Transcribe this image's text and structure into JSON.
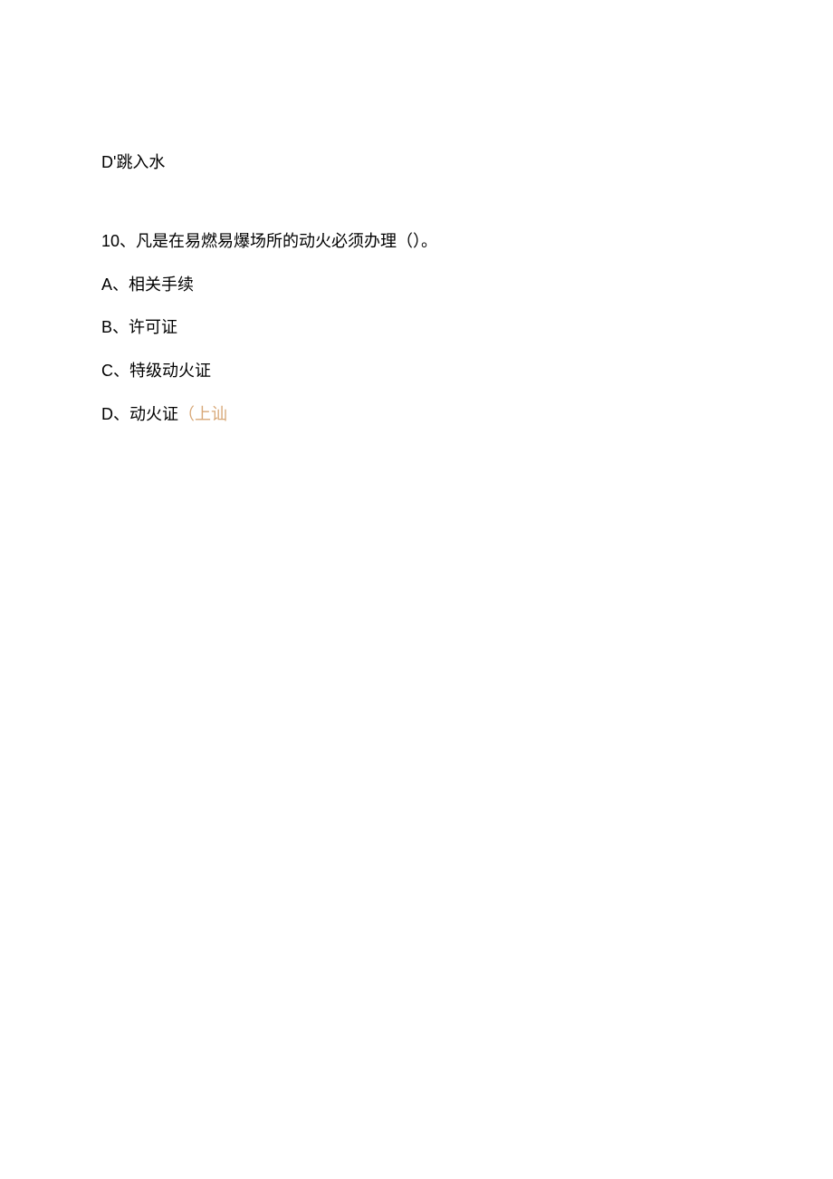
{
  "line1": {
    "letter": "D'",
    "text": "跳入水"
  },
  "question": {
    "number": "10、",
    "text": "凡是在易燃易爆场所的动火必须办理（）。"
  },
  "options": {
    "a": {
      "letter": "A、",
      "text": "相关手续"
    },
    "b": {
      "letter": "B、",
      "text": "许可证"
    },
    "c": {
      "letter": "C、",
      "text": "特级动火证"
    },
    "d": {
      "letter": "D、",
      "text": "动火证",
      "annotation": "（上讪"
    }
  }
}
